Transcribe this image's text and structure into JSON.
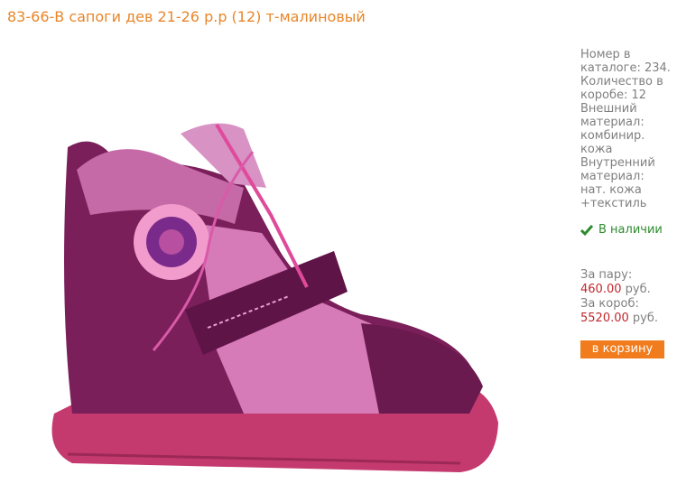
{
  "product": {
    "title": "83-66-В сапоги дев 21-26 р.р (12) т-малиновый",
    "image_alt": "сапоги детские малиновые",
    "specs": [
      "Номер в каталоге: 234.",
      "Количество в коробе: 12",
      "Внешний материал: комбинир. кожа",
      "Внутренний материал: нат. кожа +текстиль"
    ],
    "stock": {
      "icon": "check-icon",
      "text": "В наличии",
      "color": "#2e8b2e"
    },
    "prices": {
      "pair_label": "За пару:",
      "pair_value": "460.00",
      "box_label": "За короб:",
      "box_value": "5520.00",
      "currency": "руб."
    },
    "cart_button": "в корзину"
  },
  "colors": {
    "title": "#e8862a",
    "price": "#c0272d",
    "button": "#f07c1d",
    "boot_main": "#7a1f5a",
    "boot_sole": "#c43a6e"
  }
}
